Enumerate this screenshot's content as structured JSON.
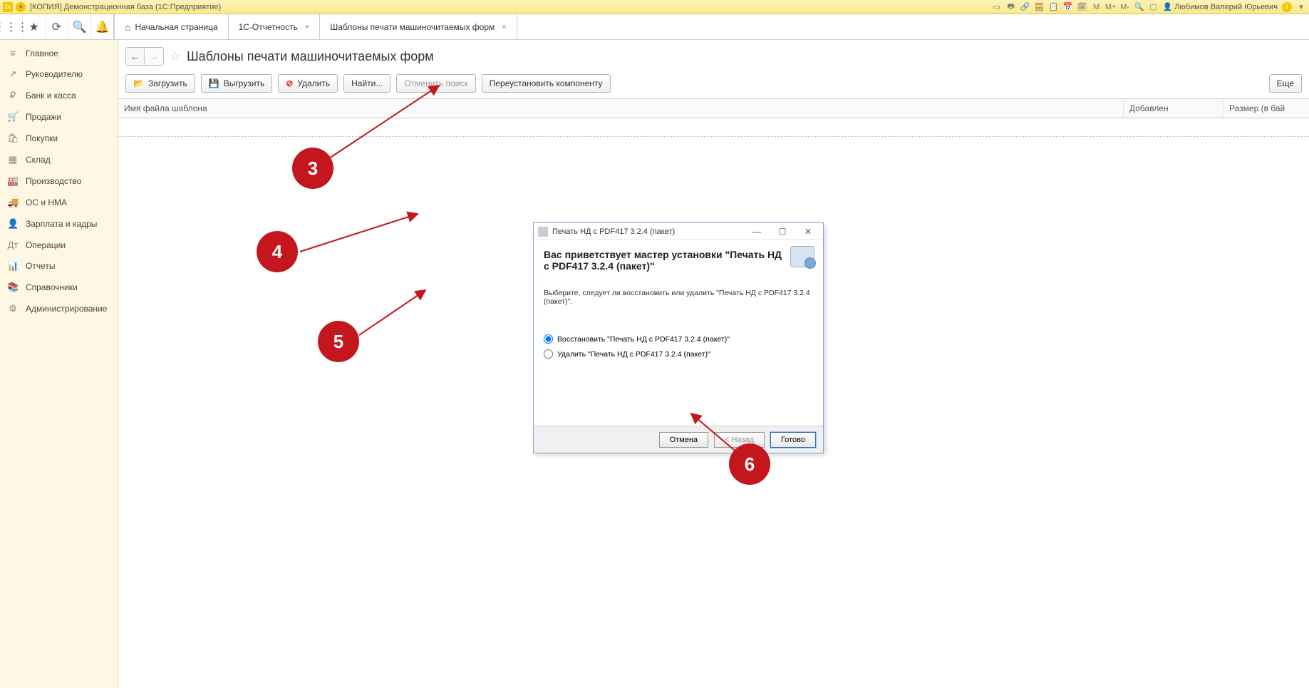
{
  "titlebar": {
    "title": "[КОПИЯ] Демонстрационная база  (1С:Предприятие)",
    "user": "Любимов Валерий Юрьевич",
    "m_labels": [
      "M",
      "M+",
      "M-"
    ]
  },
  "tabs": {
    "home": "Начальная страница",
    "t1": "1С-Отчетность",
    "t2": "Шаблоны печати машиночитаемых форм"
  },
  "sidebar": [
    {
      "icon": "≡",
      "label": "Главное"
    },
    {
      "icon": "↗",
      "label": "Руководителю"
    },
    {
      "icon": "₽",
      "label": "Банк и касса"
    },
    {
      "icon": "🛒",
      "label": "Продажи"
    },
    {
      "icon": "🛍",
      "label": "Покупки"
    },
    {
      "icon": "▦",
      "label": "Склад"
    },
    {
      "icon": "🏭",
      "label": "Производство"
    },
    {
      "icon": "🚚",
      "label": "ОС и НМА"
    },
    {
      "icon": "👤",
      "label": "Зарплата и кадры"
    },
    {
      "icon": "Дт",
      "label": "Операции"
    },
    {
      "icon": "📊",
      "label": "Отчеты"
    },
    {
      "icon": "📚",
      "label": "Справочники"
    },
    {
      "icon": "⚙",
      "label": "Администрирование"
    }
  ],
  "page": {
    "title": "Шаблоны печати машиночитаемых форм",
    "buttons": {
      "load": "Загрузить",
      "unload": "Выгрузить",
      "delete": "Удалить",
      "find": "Найти...",
      "cancel_search": "Отменить поиск",
      "reinstall": "Переустановить компоненту",
      "more": "Еще"
    },
    "columns": {
      "c1": "Имя файла шаблона",
      "c2": "Добавлен",
      "c3": "Размер (в бай"
    }
  },
  "dialog": {
    "title": "Печать НД с PDF417 3.2.4 (пакет)",
    "heading": "Вас приветствует мастер установки \"Печать НД с PDF417 3.2.4 (пакет)\"",
    "desc": "Выберите, следует ли восстановить или удалить \"Печать НД с PDF417 3.2.4 (пакет)\".",
    "opt1": "Восстановить \"Печать НД с PDF417 3.2.4 (пакет)\"",
    "opt2": "Удалить \"Печать НД с PDF417 3.2.4 (пакет)\"",
    "cancel": "Отмена",
    "back": "< Назад",
    "finish": "Готово"
  },
  "markers": {
    "m3": "3",
    "m4": "4",
    "m5": "5",
    "m6": "6"
  }
}
